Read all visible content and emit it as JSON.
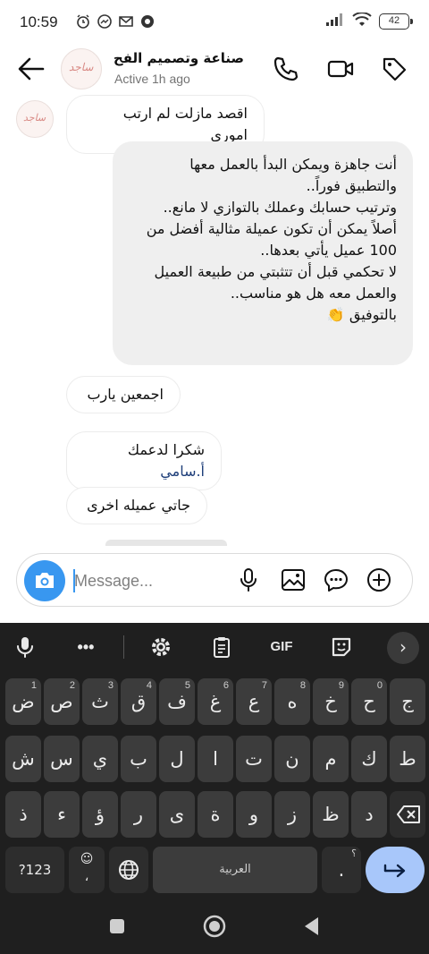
{
  "status_bar": {
    "time": "10:59",
    "battery": "42"
  },
  "header": {
    "contact_name": "صناعة وتصميم الفح...",
    "status": "Active 1h ago",
    "avatar_text": "ساجد"
  },
  "messages": [
    {
      "direction": "in",
      "text": "اقصد مازلت لم ارتب اموري"
    },
    {
      "direction": "out",
      "text": "أنت جاهزة ويمكن البدأ بالعمل معها\nوالتطبيق فوراً..\nوترتيب حسابك وعملك بالتوازي لا مانع..\nأصلاً يمكن أن تكون عميلة مثالية أفضل من\n100 عميل يأتي بعدها..\nلا تحكمي قبل أن تتثبتي من طبيعة العميل\nوالعمل معه هل هو مناسب..\nبالتوفيق 👏"
    },
    {
      "direction": "in",
      "text": "اجمعين يارب"
    },
    {
      "direction": "in",
      "text_prefix": "شكرا لدعمك ",
      "mention": "أ.سامي"
    },
    {
      "direction": "in",
      "text": "جاتي عميله اخرى"
    }
  ],
  "composer": {
    "placeholder": "Message..."
  },
  "keyboard": {
    "toolbar": {
      "gif": "GIF"
    },
    "row1": [
      {
        "k": "ض",
        "h": "1"
      },
      {
        "k": "ص",
        "h": "2"
      },
      {
        "k": "ث",
        "h": "3"
      },
      {
        "k": "ق",
        "h": "4"
      },
      {
        "k": "ف",
        "h": "5"
      },
      {
        "k": "غ",
        "h": "6"
      },
      {
        "k": "ع",
        "h": "7"
      },
      {
        "k": "ه",
        "h": "8"
      },
      {
        "k": "خ",
        "h": "9"
      },
      {
        "k": "ح",
        "h": "0"
      },
      {
        "k": "ج",
        "h": ""
      }
    ],
    "row2": [
      "ش",
      "س",
      "ي",
      "ب",
      "ل",
      "ا",
      "ت",
      "ن",
      "م",
      "ك",
      "ط"
    ],
    "row3": [
      "ذ",
      "ء",
      "ؤ",
      "ر",
      "ى",
      "ة",
      "و",
      "ز",
      "ظ",
      "د"
    ],
    "symbols_key": "?123",
    "emoji_key_sub": "،",
    "space_label": "العربية",
    "period_key": ".",
    "period_hint": "؟"
  },
  "colors": {
    "accent": "#3897f0",
    "keyboard_bg": "#1f1f1f",
    "key_bg": "#3c3c3c",
    "enter_bg": "#a8c7fa"
  }
}
